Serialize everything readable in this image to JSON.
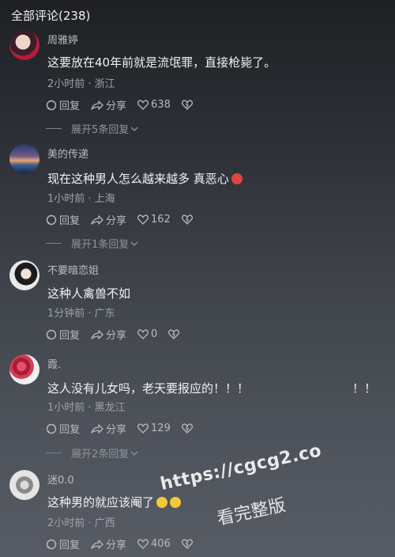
{
  "header": {
    "title": "全部评论(238)"
  },
  "actions": {
    "reply": "回复",
    "share": "分享"
  },
  "comments": [
    {
      "name": "周雅婷",
      "text": "这要放在40年前就是流氓罪，直接枪毙了。",
      "meta": "2小时前 · 浙江",
      "likes": "638",
      "expand": "展开5条回复"
    },
    {
      "name": "美的传递",
      "text": "现在这种男人怎么越来越多 真恶心",
      "meta": "1小时前 · 上海",
      "likes": "162",
      "expand": "展开1条回复"
    },
    {
      "name": "不要暗恋姐",
      "text": "这种人禽兽不如",
      "meta": "1分钟前 · 广东",
      "likes": "0"
    },
    {
      "name": "霞.",
      "text": "这人没有儿女吗，老天要报应的！！！",
      "text_extra": "！！",
      "meta": "1小时前 · 黑龙江",
      "likes": "129",
      "expand": "展开2条回复"
    },
    {
      "name": "迷0.0",
      "text": "这种男的就应该阉了",
      "meta": "2小时前 · 广西",
      "likes": "406"
    }
  ],
  "watermark": {
    "url": "https://cgcg2.co",
    "label": "看完整版"
  },
  "icons": [
    "reply-icon",
    "share-icon",
    "heart-icon",
    "dislike-icon",
    "chevron-down-icon"
  ]
}
